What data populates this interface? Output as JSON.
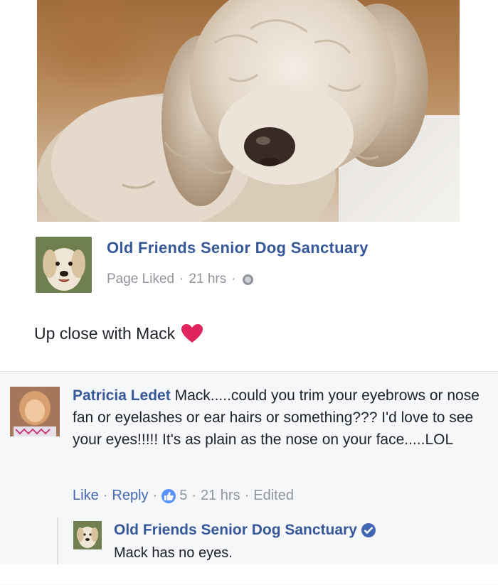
{
  "post": {
    "page_name": "Old Friends Senior Dog Sanctuary",
    "status": "Page Liked",
    "time": "21 hrs",
    "caption": "Up close with Mack"
  },
  "comment": {
    "author": "Patricia Ledet",
    "text": "Mack.....could you trim your eyebrows or nose fan or eyelashes or ear hairs or something??? I'd love to see your eyes!!!!! It's as plain as the nose on your face.....LOL",
    "actions": {
      "like_label": "Like",
      "reply_label": "Reply",
      "reaction_count": "5",
      "time": "21 hrs",
      "edited_label": "Edited"
    }
  },
  "reply": {
    "author": "Old Friends Senior Dog Sanctuary",
    "text": "Mack has no eyes."
  },
  "colors": {
    "link_blue": "#365899",
    "meta_gray": "#90949c",
    "heart": "#e0245e",
    "comment_bg": "#f6f7f9"
  },
  "icons": [
    "globe-icon",
    "heart-icon",
    "like-icon",
    "verified-icon"
  ]
}
